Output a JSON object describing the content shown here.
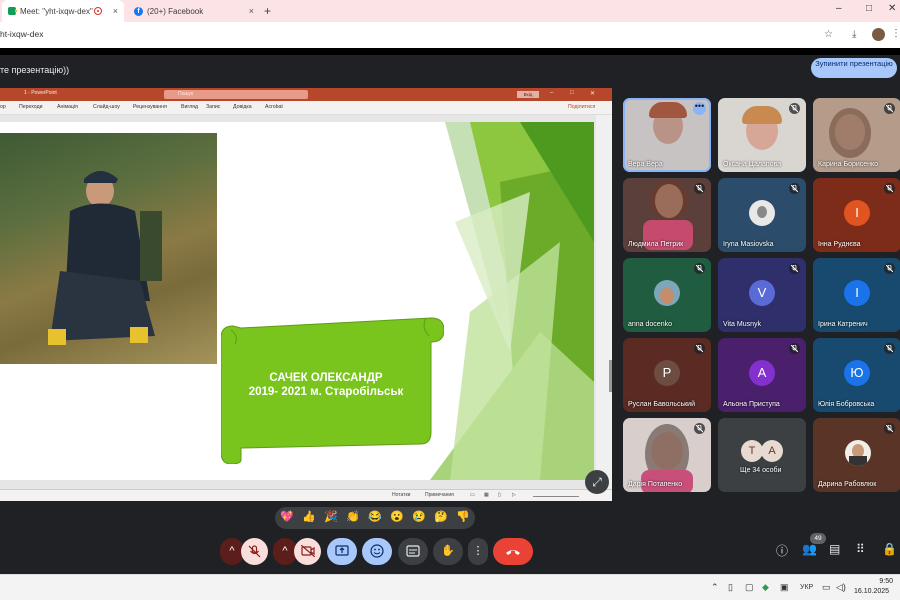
{
  "browser": {
    "tabs": [
      {
        "title": "Meet: \"yht-ixqw-dex\"",
        "close": "×"
      },
      {
        "title": "(20+) Facebook",
        "close": "×"
      }
    ],
    "new_tab": "+",
    "window_controls": {
      "minimize": "–",
      "maximize": "□",
      "close": "✕"
    },
    "url": "ht-ixqw-dex"
  },
  "meet": {
    "presenting_text": "те презентацію))",
    "stop_presenting_button": "Зупинити презентацію",
    "participant_count": "49",
    "participants": [
      {
        "name": "Вера Вера",
        "speaking": true
      },
      {
        "name": "Оксана Цалапова"
      },
      {
        "name": "Карина Борисенко"
      },
      {
        "name": "Людмила Петрик"
      },
      {
        "name": "Iryna Masiovska"
      },
      {
        "name": "Інна Руднєва",
        "initial": "І",
        "color": "#e0541f"
      },
      {
        "name": "anna docenko"
      },
      {
        "name": "Vita Musnyk",
        "initial": "V",
        "color": "#5b6bd6"
      },
      {
        "name": "Ірина Катренич",
        "initial": "І",
        "color": "#1a73e8"
      },
      {
        "name": "Руслан Бавольський",
        "initial": "Р",
        "color": "#6d4c41"
      },
      {
        "name": "Альона Приступа",
        "initial": "А",
        "color": "#8430ce"
      },
      {
        "name": "Юлія Бобровська",
        "initial": "Ю",
        "color": "#1a73e8"
      },
      {
        "name": "Дарія Потапенко"
      },
      {
        "name": "Ще 34 особи",
        "initials": [
          "Т",
          "А"
        ]
      },
      {
        "name": "Дарина Рабовлюк"
      }
    ],
    "reactions": [
      "💖",
      "👍",
      "🎉",
      "👏",
      "😂",
      "😮",
      "😢",
      "🤔",
      "👎"
    ]
  },
  "powerpoint": {
    "doc_title": "1 - PowerPoint",
    "search_placeholder": "Пошук",
    "sign_in": "Вхід",
    "ribbon_tabs": [
      "ор",
      "Переходи",
      "Анімація",
      "Слайд-шоу",
      "Рецензування",
      "Вигляд",
      "Запис",
      "Довідка",
      "Acrobat"
    ],
    "share": "Поділитися",
    "status": {
      "notes": "Нотатки",
      "comments": "Примечания"
    }
  },
  "slide": {
    "line1": "САЧЕК ОЛЕКСАНДР",
    "line2": "2019- 2021 м. Старобільськ"
  },
  "taskbar": {
    "language": "УКР",
    "time": "9:50",
    "date": "16.10.2025"
  }
}
